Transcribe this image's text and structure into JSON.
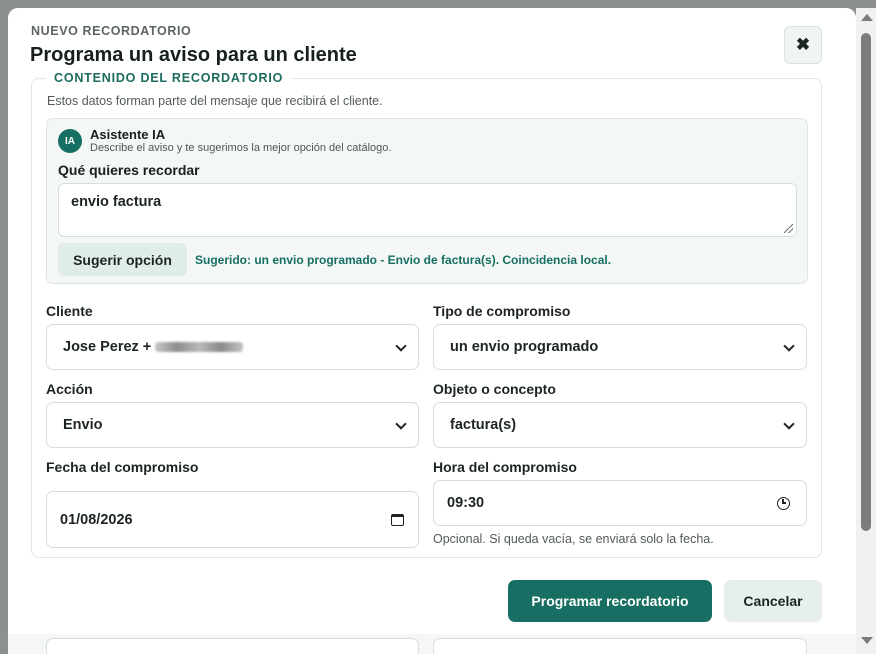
{
  "modal": {
    "eyebrow": "NUEVO RECORDATORIO",
    "title": "Programa un aviso para un cliente",
    "close_icon": "close-icon"
  },
  "section": {
    "legend": "CONTENIDO DEL RECORDATORIO",
    "description": "Estos datos forman parte del mensaje que recibirá el cliente."
  },
  "assistant": {
    "avatar": "IA",
    "name": "Asistente IA",
    "subtitle": "Describe el aviso y te sugerimos la mejor opción del catálogo.",
    "label": "Qué quieres recordar",
    "value": "envio factura",
    "suggest_button": "Sugerir opción",
    "suggestion": "Sugerido: un envio programado - Envio de factura(s). Coincidencia local."
  },
  "form": {
    "cliente_label": "Cliente",
    "cliente_value": "Jose Perez +",
    "tipo_label": "Tipo de compromiso",
    "tipo_value": "un envio programado",
    "accion_label": "Acción",
    "accion_value": "Envio",
    "objeto_label": "Objeto o concepto",
    "objeto_value": "factura(s)",
    "fecha_label": "Fecha del compromiso",
    "fecha_value": "01/08/2026",
    "hora_label": "Hora del compromiso",
    "hora_value": "09:30",
    "hora_hint": "Opcional. Si queda vacía, se enviará solo la fecha."
  },
  "actions": {
    "primary": "Programar recordatorio",
    "secondary": "Cancelar"
  }
}
